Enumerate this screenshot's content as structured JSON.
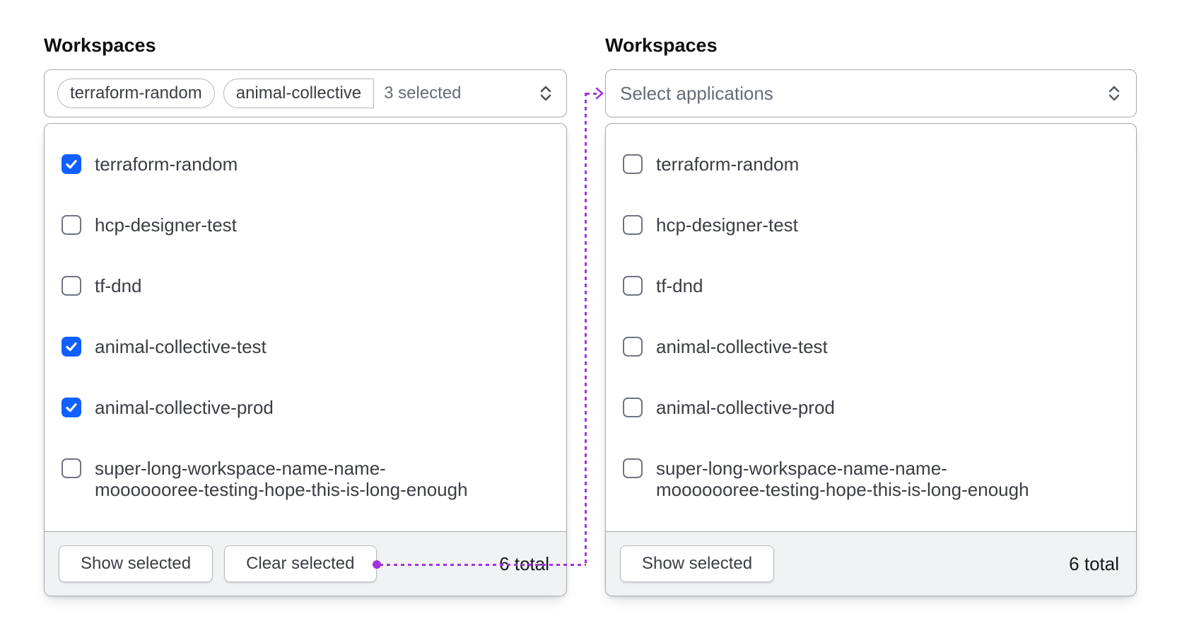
{
  "colors": {
    "connector_purple": "#a332e2",
    "checkbox_selected_blue": "#1060ff"
  },
  "icons": {
    "trigger_chevron": "unfold-chevrons-icon",
    "checkbox_check": "checkmark-icon",
    "connector_arrow": "arrow-right-chevron-icon"
  },
  "left_panel": {
    "label": "Workspaces",
    "trigger": {
      "tags": [
        "terraform-random",
        "animal-collective"
      ],
      "count_text": "3 selected"
    },
    "options": [
      {
        "label": "terraform-random",
        "checked": true
      },
      {
        "label": "hcp-designer-test",
        "checked": false
      },
      {
        "label": "tf-dnd",
        "checked": false
      },
      {
        "label": "animal-collective-test",
        "checked": true
      },
      {
        "label": "animal-collective-prod",
        "checked": true
      },
      {
        "label_line1": "super-long-workspace-name-name-",
        "label_line2": "mooooooree-testing-hope-this-is-long-enough",
        "checked": false
      }
    ],
    "footer": {
      "show_selected": "Show selected",
      "clear_selected": "Clear selected",
      "total": "6 total"
    }
  },
  "right_panel": {
    "label": "Workspaces",
    "trigger": {
      "placeholder": "Select applications"
    },
    "options": [
      {
        "label": "terraform-random",
        "checked": false
      },
      {
        "label": "hcp-designer-test",
        "checked": false
      },
      {
        "label": "tf-dnd",
        "checked": false
      },
      {
        "label": "animal-collective-test",
        "checked": false
      },
      {
        "label": "animal-collective-prod",
        "checked": false
      },
      {
        "label_line1": "super-long-workspace-name-name-",
        "label_line2": "mooooooree-testing-hope-this-is-long-enough",
        "checked": false
      }
    ],
    "footer": {
      "show_selected": "Show selected",
      "total": "6 total"
    }
  }
}
